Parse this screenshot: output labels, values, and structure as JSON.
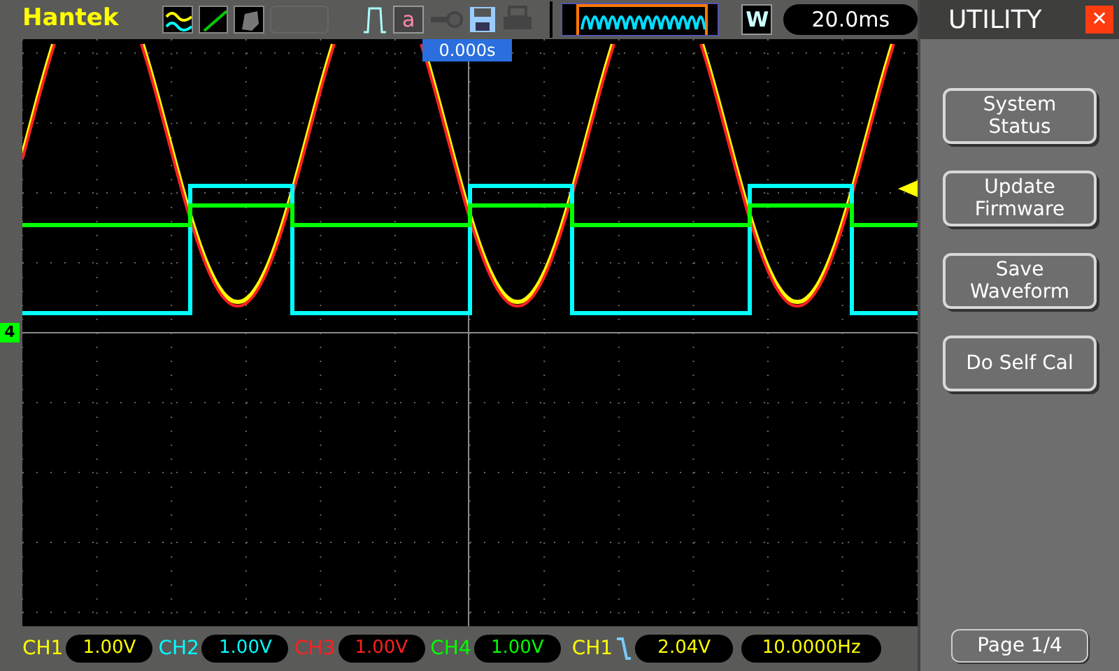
{
  "brand": "Hantek",
  "toolbar": {
    "text_button": "a",
    "window_button": "W",
    "timebase": "20.0ms"
  },
  "trigger_position": "0.000s",
  "ground_marker": "4",
  "menu": {
    "title": "UTILITY",
    "close": "✕",
    "buttons": [
      "System Status",
      "Update Firmware",
      "Save Waveform",
      "Do Self Cal"
    ],
    "page": "Page 1/4"
  },
  "channels": [
    {
      "label": "CH1",
      "value": "1.00V",
      "color": "#ffff00"
    },
    {
      "label": "CH2",
      "value": "1.00V",
      "color": "#00ffff"
    },
    {
      "label": "CH3",
      "value": "1.00V",
      "color": "#ff2020"
    },
    {
      "label": "CH4",
      "value": "1.00V",
      "color": "#00ff00"
    }
  ],
  "trigger": {
    "source": "CH1",
    "level": "2.04V"
  },
  "frequency": "10.0000Hz"
}
